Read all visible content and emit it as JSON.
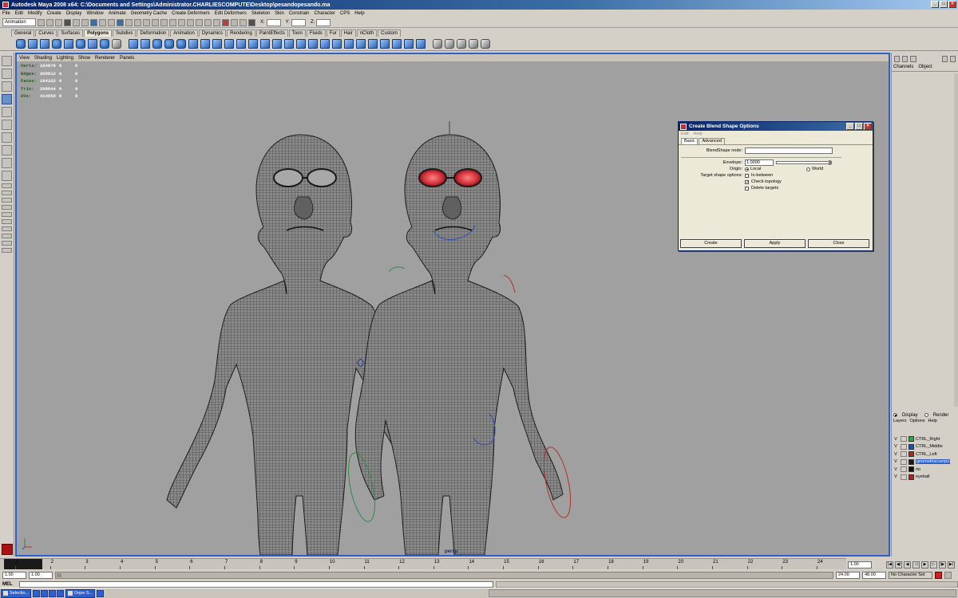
{
  "window": {
    "title": "Autodesk Maya 2008 x64: C:\\Documents and Settings\\Administrator.CHARLIESCOMPUTE\\Desktop\\pesandopesando.ma"
  },
  "menubar": [
    "File",
    "Edit",
    "Modify",
    "Create",
    "Display",
    "Window",
    "Animate",
    "Geometry Cache",
    "Create Deformers",
    "Edit Deformers",
    "Skeleton",
    "Skin",
    "Constrain",
    "Character",
    "CPS",
    "Help"
  ],
  "statusline": {
    "mode": "Animation",
    "coord_labels": [
      "X:",
      "Y:",
      "Z:"
    ]
  },
  "shelf": {
    "tabs": [
      "General",
      "Curves",
      "Surfaces",
      "Polygons",
      "Subdivs",
      "Deformation",
      "Animation",
      "Dynamics",
      "Rendering",
      "PaintEffects",
      "Toon",
      "Fluids",
      "Fur",
      "Hair",
      "nCloth",
      "Custom"
    ],
    "active_tab": "Polygons"
  },
  "viewport": {
    "menu": [
      "View",
      "Shading",
      "Lighting",
      "Show",
      "Renderer",
      "Panels"
    ],
    "hud": [
      {
        "label": "Verts:",
        "v1": "104676",
        "v2": "0",
        "v3": "0"
      },
      {
        "label": "Edges:",
        "v1": "209812",
        "v2": "0",
        "v3": "0"
      },
      {
        "label": "Faces:",
        "v1": "104322",
        "v2": "0",
        "v3": "0"
      },
      {
        "label": "Tris:",
        "v1": "208644",
        "v2": "0",
        "v3": "0"
      },
      {
        "label": "UVs:",
        "v1": "414058",
        "v2": "0",
        "v3": "0"
      }
    ],
    "camera": "persp",
    "eye_color": "#d0303a"
  },
  "dialog": {
    "title": "Create Blend Shape Options",
    "menu": [
      "Edit",
      "Help"
    ],
    "tabs": [
      "Basic",
      "Advanced"
    ],
    "active_tab": "Basic",
    "node_label": "BlendShape node:",
    "node_value": "",
    "envelope_label": "Envelope:",
    "envelope_value": "1.0000",
    "envelope_fraction": 1.0,
    "origin_label": "Origin:",
    "origin_local": "Local",
    "origin_world": "World",
    "target_label": "Target shape options:",
    "opt_inbetween": "In-between",
    "opt_check_topology": "Check topology",
    "opt_delete_targets": "Delete targets",
    "checked": {
      "inbetween": false,
      "check_topology": true,
      "delete_targets": false
    },
    "buttons": {
      "create": "Create",
      "apply": "Apply",
      "close": "Close"
    }
  },
  "channelbox": {
    "tabs": [
      "Channels",
      "Object"
    ],
    "layer_mode": {
      "display": "Display",
      "render": "Render",
      "selected": "Display"
    },
    "layer_menu": [
      "Layers",
      "Options",
      "Help"
    ],
    "layers": [
      {
        "vis": "V",
        "name": "CTRL_Right",
        "color": "#2aa84a",
        "selected": false
      },
      {
        "vis": "V",
        "name": "CTRL_Middle",
        "color": "#1a4fbf",
        "selected": false
      },
      {
        "vis": "V",
        "name": "CTRL_Left",
        "color": "#c02020",
        "selected": false
      },
      {
        "vis": "V",
        "name": "geometriacuerpo",
        "color": "#1a1a1a",
        "selected": true
      },
      {
        "vis": "V",
        "name": "rio",
        "color": "#111111",
        "selected": false
      },
      {
        "vis": "V",
        "name": "eyeball",
        "color": "#b82020",
        "selected": false
      }
    ]
  },
  "timeline": {
    "ticks": [
      "1",
      "2",
      "3",
      "4",
      "5",
      "6",
      "7",
      "8",
      "9",
      "10",
      "11",
      "12",
      "13",
      "14",
      "15",
      "16",
      "17",
      "18",
      "19",
      "20",
      "21",
      "22",
      "23",
      "24"
    ],
    "current_frame": "1.00",
    "range_start": "1.00",
    "range_start2": "1.00",
    "range_end": "24.00",
    "range_end2": "48.00",
    "character_set": "No Character Set"
  },
  "cmdline": {
    "label": "MEL"
  },
  "taskbar": [
    {
      "label": "Selectio..."
    },
    {
      "label": "Dope S..."
    }
  ]
}
